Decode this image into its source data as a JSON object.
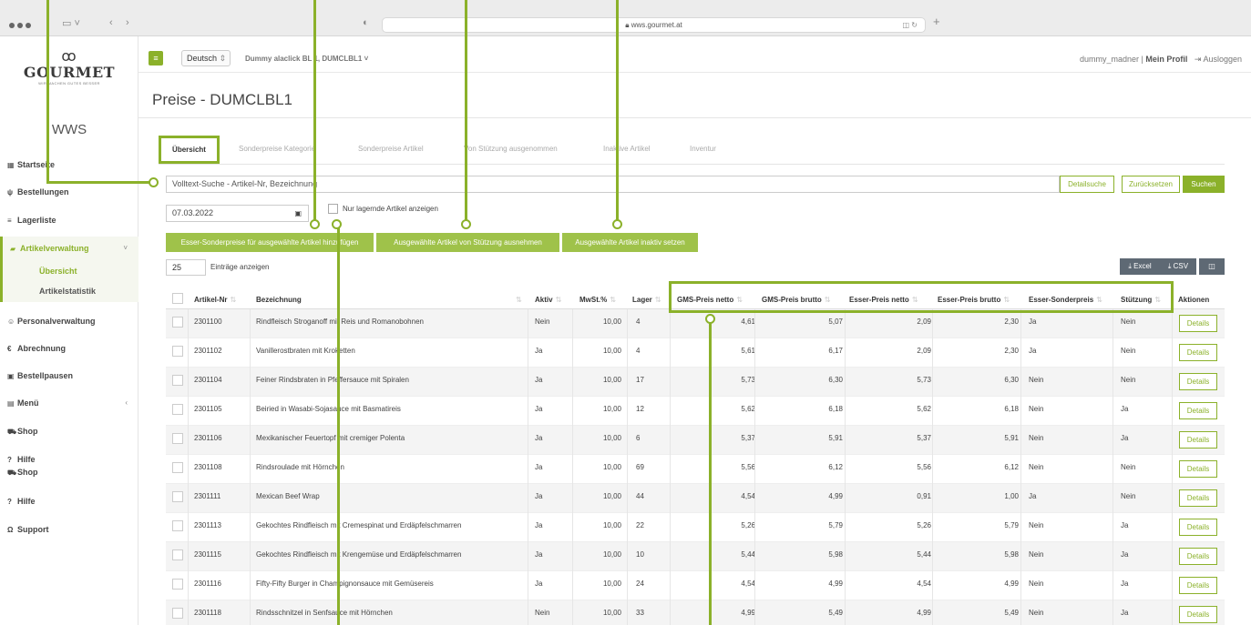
{
  "browser": {
    "url": "wws.gourmet.at"
  },
  "brand": {
    "mark": "ꝏ",
    "name": "GOURMET",
    "slogan": "WIR MACHEN GUTES BESSER",
    "app": "WWS"
  },
  "sidebar": {
    "items": [
      {
        "label": "Startseite",
        "icon": "grid-icon"
      },
      {
        "label": "Bestellungen",
        "icon": "cutlery-icon"
      },
      {
        "label": "Lagerliste",
        "icon": "list-icon"
      },
      {
        "label": "Artikelverwaltung",
        "icon": "folder-icon",
        "active": true
      },
      {
        "label": "Personalverwaltung",
        "icon": "users-icon"
      },
      {
        "label": "Abrechnung",
        "icon": "euro-icon"
      },
      {
        "label": "Bestellpausen",
        "icon": "calendar-icon"
      },
      {
        "label": "Menü",
        "icon": "book-icon"
      },
      {
        "label": "Shop",
        "icon": "cart-icon"
      },
      {
        "label": "Hilfe",
        "icon": "question-icon"
      },
      {
        "label": "Shop",
        "icon": "cart-icon"
      },
      {
        "label": "Hilfe",
        "icon": "question-icon"
      },
      {
        "label": "Support",
        "icon": "headset-icon"
      }
    ],
    "subitems": [
      {
        "label": "Übersicht",
        "active": true
      },
      {
        "label": "Artikelstatistik"
      }
    ]
  },
  "topbar": {
    "language": "Deutsch",
    "tenant": "Dummy alaclick BL 1, DUMCLBL1",
    "user": "dummy_madner",
    "separator": "|",
    "profile": "Mein Profil",
    "logout": "Ausloggen"
  },
  "page": {
    "title": "Preise - DUMCLBL1"
  },
  "tabs": [
    "Übersicht",
    "Sonderpreise Kategorie",
    "Sonderpreise Artikel",
    "Von Stützung ausgenommen",
    "Inaktive Artikel",
    "Inventur"
  ],
  "search": {
    "placeholder": "Volltext-Suche - Artikel-Nr, Bezeichnung",
    "detail": "Detailsuche",
    "reset": "Zurücksetzen",
    "submit": "Suchen"
  },
  "filters": {
    "date": "07.03.2022",
    "only_stock": "Nur lagernde Artikel anzeigen"
  },
  "actions": [
    "Esser-Sonderpreise für ausgewählte Artikel hinzufügen",
    "Ausgewählte Artikel von Stützung ausnehmen",
    "Ausgewählte Artikel inaktiv setzen"
  ],
  "list": {
    "entries": "25",
    "entries_label": "Einträge anzeigen",
    "excel": "Excel",
    "csv": "CSV"
  },
  "table": {
    "columns": [
      "Artikel-Nr",
      "Bezeichnung",
      "Aktiv",
      "MwSt.%",
      "Lager",
      "GMS-Preis netto",
      "GMS-Preis brutto",
      "Esser-Preis netto",
      "Esser-Preis brutto",
      "Esser-Sonderpreis",
      "Stützung",
      "Aktionen"
    ],
    "details_label": "Details",
    "rows": [
      [
        "2301100",
        "Rindfleisch Stroganoff mit Reis und Romanobohnen",
        "Nein",
        "10,00",
        "4",
        "4,61",
        "5,07",
        "2,09",
        "2,30",
        "Ja",
        "Nein"
      ],
      [
        "2301102",
        "Vanillerostbraten mit Kroketten",
        "Ja",
        "10,00",
        "4",
        "5,61",
        "6,17",
        "2,09",
        "2,30",
        "Ja",
        "Nein"
      ],
      [
        "2301104",
        "Feiner Rindsbraten in Pfeffersauce mit Spiralen",
        "Ja",
        "10,00",
        "17",
        "5,73",
        "6,30",
        "5,73",
        "6,30",
        "Nein",
        "Nein"
      ],
      [
        "2301105",
        "Beiried in Wasabi-Sojasauce mit Basmatireis",
        "Ja",
        "10,00",
        "12",
        "5,62",
        "6,18",
        "5,62",
        "6,18",
        "Nein",
        "Ja"
      ],
      [
        "2301106",
        "Mexikanischer Feuertopf mit cremiger Polenta",
        "Ja",
        "10,00",
        "6",
        "5,37",
        "5,91",
        "5,37",
        "5,91",
        "Nein",
        "Ja"
      ],
      [
        "2301108",
        "Rindsroulade mit Hörnchen",
        "Ja",
        "10,00",
        "69",
        "5,56",
        "6,12",
        "5,56",
        "6,12",
        "Nein",
        "Nein"
      ],
      [
        "2301111",
        "Mexican Beef Wrap",
        "Ja",
        "10,00",
        "44",
        "4,54",
        "4,99",
        "0,91",
        "1,00",
        "Ja",
        "Nein"
      ],
      [
        "2301113",
        "Gekochtes Rindfleisch mit Cremespinat und Erdäpfelschmarren",
        "Ja",
        "10,00",
        "22",
        "5,26",
        "5,79",
        "5,26",
        "5,79",
        "Nein",
        "Ja"
      ],
      [
        "2301115",
        "Gekochtes Rindfleisch mit Krengemüse und Erdäpfelschmarren",
        "Ja",
        "10,00",
        "10",
        "5,44",
        "5,98",
        "5,44",
        "5,98",
        "Nein",
        "Ja"
      ],
      [
        "2301116",
        "Fifty-Fifty Burger in Champignonsauce mit Gemüsereis",
        "Ja",
        "10,00",
        "24",
        "4,54",
        "4,99",
        "4,54",
        "4,99",
        "Nein",
        "Ja"
      ],
      [
        "2301118",
        "Rindsschnitzel in Senfsauce mit Hörnchen",
        "Nein",
        "10,00",
        "33",
        "4,99",
        "5,49",
        "4,99",
        "5,49",
        "Nein",
        "Ja"
      ]
    ]
  },
  "colors": {
    "accent": "#8bb12a",
    "button": "#9fc24a",
    "dark_button": "#5e6974"
  }
}
